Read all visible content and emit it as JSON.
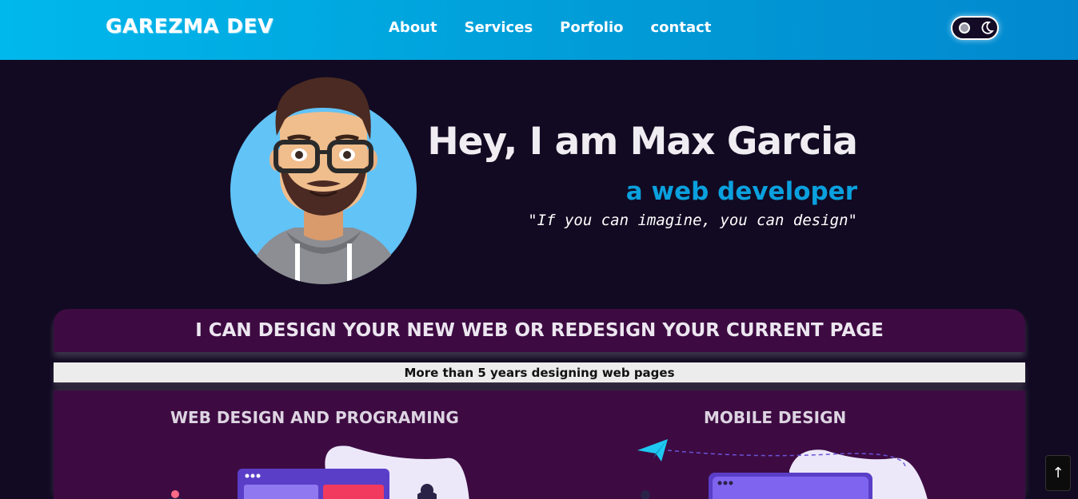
{
  "header": {
    "logo": "GAREZMA DEV",
    "nav": [
      {
        "label": "About"
      },
      {
        "label": "Services"
      },
      {
        "label": "Porfolio"
      },
      {
        "label": "contact"
      }
    ],
    "theme_toggle": {
      "state": "dark"
    }
  },
  "hero": {
    "title": "Hey, I am Max Garcia",
    "subtitle": "a web developer",
    "quote": "\"If you can imagine, you can design\""
  },
  "banner": {
    "text": "I CAN DESIGN YOUR NEW WEB OR REDESIGN YOUR CURRENT PAGE"
  },
  "experience": {
    "text": "More than 5 years designing web pages"
  },
  "services": {
    "items": [
      {
        "title": "WEB DESIGN AND PROGRAMING"
      },
      {
        "title": "MOBILE DESIGN"
      }
    ]
  },
  "scroll_top": {
    "icon": "↑"
  },
  "colors": {
    "header_start": "#00b8ec",
    "header_end": "#0288cf",
    "background": "#120a22",
    "accent": "#0aa0de",
    "panel": "#3d0b42"
  }
}
